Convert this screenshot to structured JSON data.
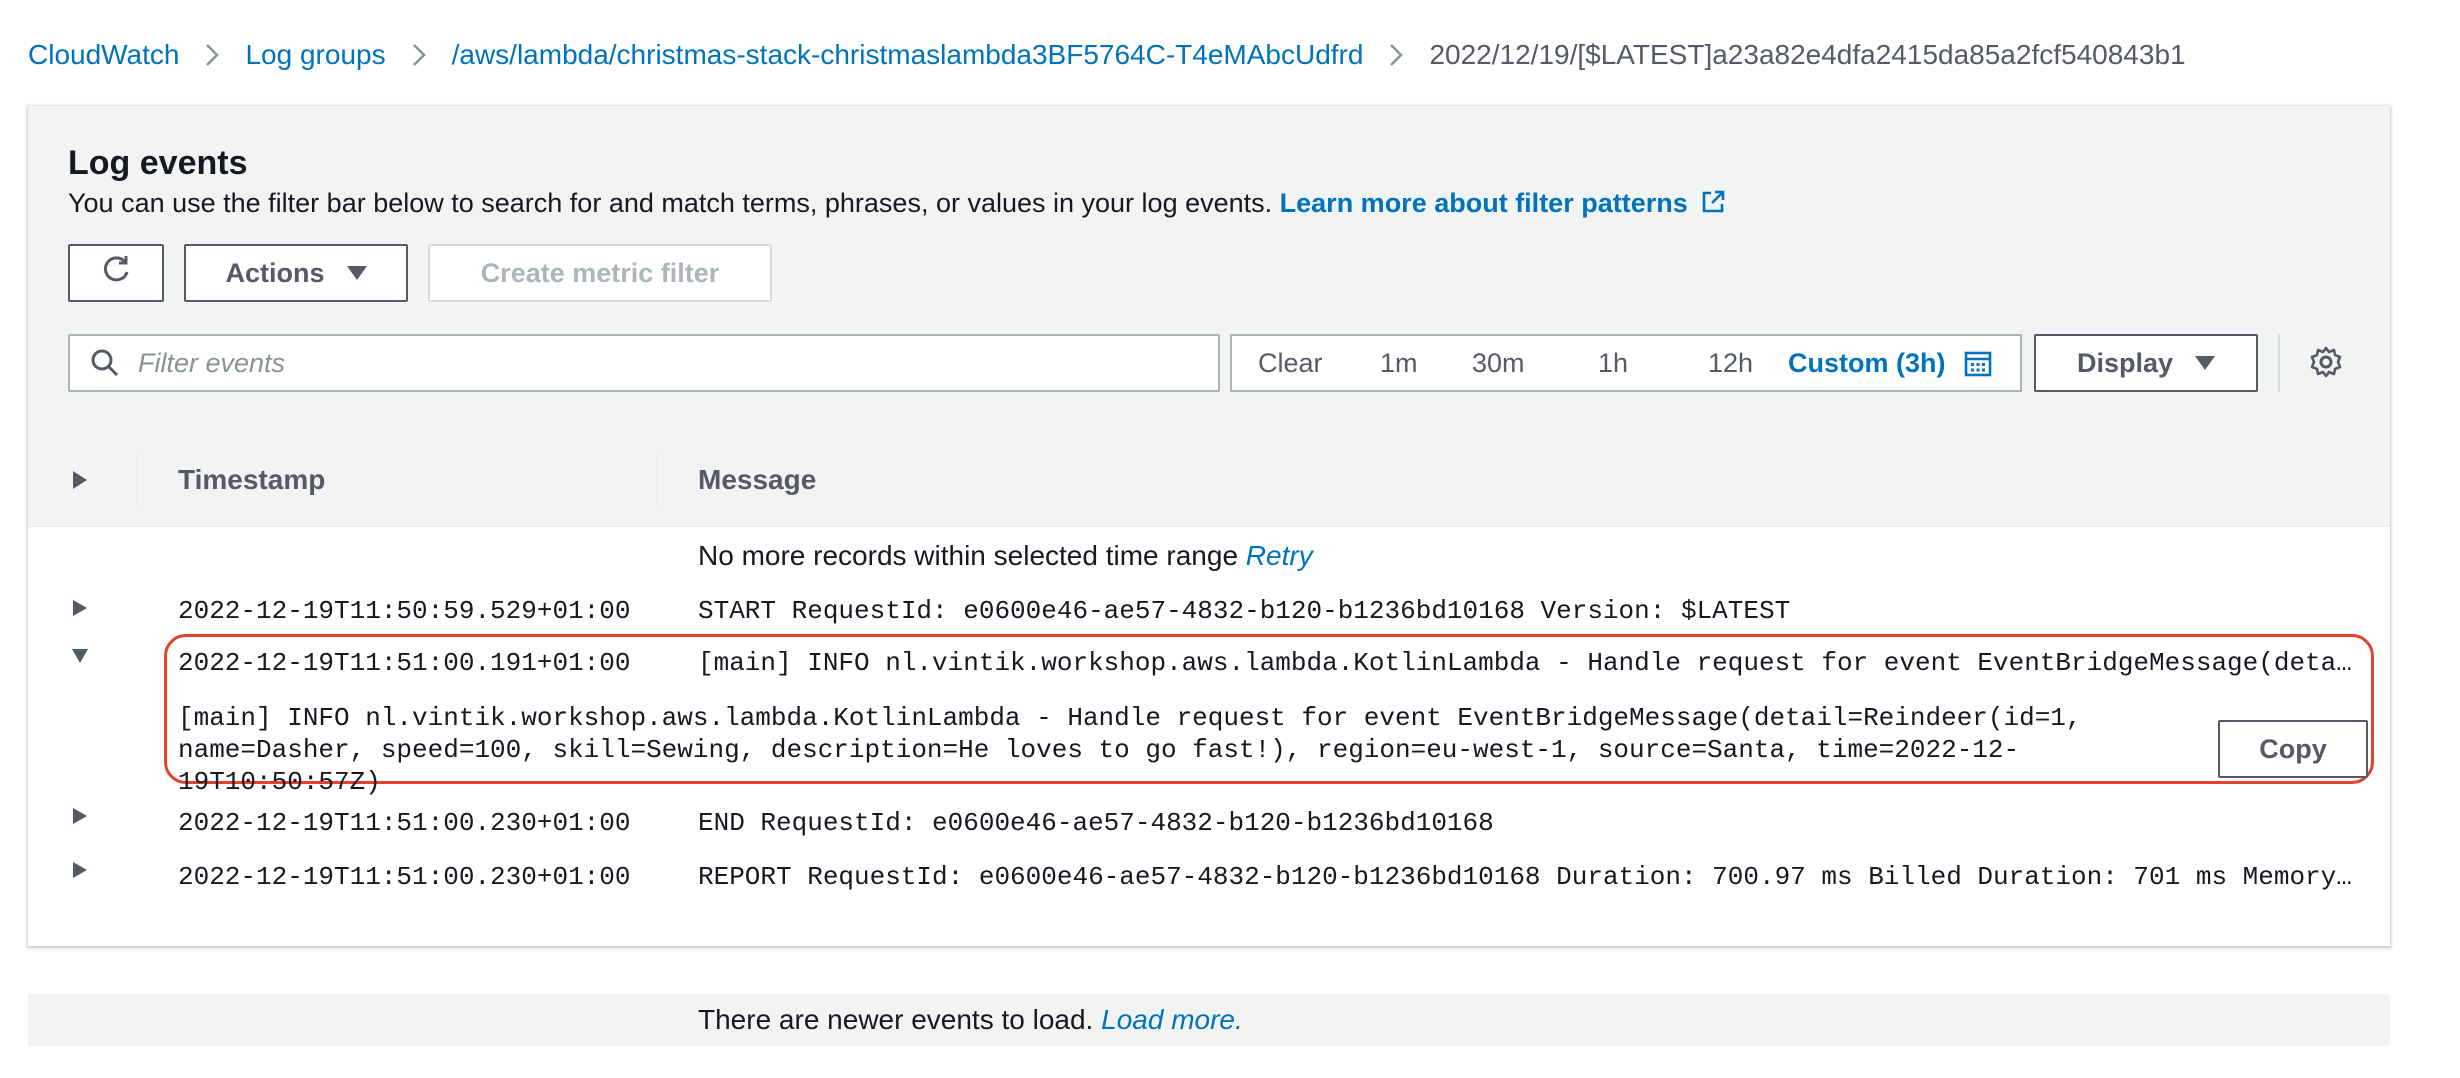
{
  "breadcrumb": {
    "cloudwatch": "CloudWatch",
    "log_groups": "Log groups",
    "log_group": "/aws/lambda/christmas-stack-christmaslambda3BF5764C-T4eMAbcUdfrd",
    "log_stream": "2022/12/19/[$LATEST]a23a82e4dfa2415da85a2fcf540843b1"
  },
  "panel": {
    "title": "Log events",
    "description": "You can use the filter bar below to search for and match terms, phrases, or values in your log events.",
    "learn_more": "Learn more about filter patterns"
  },
  "toolbar": {
    "actions_label": "Actions",
    "create_metric_filter_label": "Create metric filter",
    "display_label": "Display"
  },
  "search": {
    "placeholder": "Filter events"
  },
  "time_range": {
    "clear": "Clear",
    "options": [
      "1m",
      "30m",
      "1h",
      "12h"
    ],
    "custom": "Custom (3h)"
  },
  "table": {
    "columns": [
      "Timestamp",
      "Message"
    ],
    "top_status": "No more records within selected time range",
    "retry_link": "Retry",
    "rows": [
      {
        "timestamp": "2022-12-19T11:50:59.529+01:00",
        "message": "START RequestId: e0600e46-ae57-4832-b120-b1236bd10168 Version: $LATEST"
      },
      {
        "timestamp": "2022-12-19T11:51:00.191+01:00",
        "message": "[main] INFO nl.vintik.workshop.aws.lambda.KotlinLambda - Handle request for event EventBridgeMessage(detail=Reind…",
        "detail": "[main] INFO nl.vintik.workshop.aws.lambda.KotlinLambda - Handle request for event EventBridgeMessage(detail=Reindeer(id=1, name=Dasher, speed=100, skill=Sewing, description=He loves to go fast!), region=eu-west-1, source=Santa, time=2022-12-19T10:50:57Z)",
        "copy_label": "Copy"
      },
      {
        "timestamp": "2022-12-19T11:51:00.230+01:00",
        "message": "END RequestId: e0600e46-ae57-4832-b120-b1236bd10168"
      },
      {
        "timestamp": "2022-12-19T11:51:00.230+01:00",
        "message": "REPORT RequestId: e0600e46-ae57-4832-b120-b1236bd10168 Duration: 700.97 ms Billed Duration: 701 ms Memory Size: 5…"
      }
    ],
    "bottom_status": "There are newer events to load.",
    "load_more_link": "Load more."
  },
  "colors": {
    "link": "#0073bb",
    "highlight_border": "#e0442f",
    "header_bg": "#f2f3f3",
    "text": "#16191f"
  },
  "icons": [
    "chevron-right-icon",
    "external-link-icon",
    "refresh-icon",
    "caret-down-icon",
    "search-icon",
    "calendar-icon",
    "gear-icon",
    "expand-right-icon",
    "expand-down-icon"
  ]
}
